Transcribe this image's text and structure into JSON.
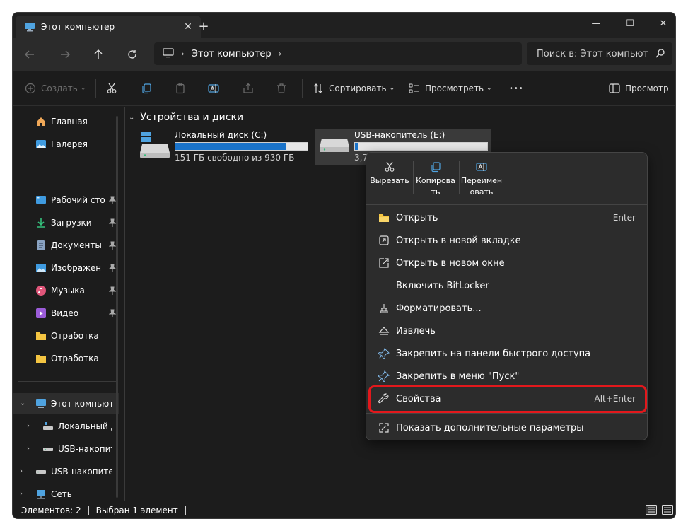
{
  "tab": {
    "title": "Этот компьютер",
    "close": "✕",
    "new": "+"
  },
  "window_controls": {
    "minimize": "—",
    "maximize": "☐",
    "close": "✕"
  },
  "address": {
    "path": "Этот компьютер"
  },
  "search": {
    "placeholder": "Поиск в: Этот компьют"
  },
  "toolbar": {
    "create": "Создать",
    "sort": "Сортировать",
    "view": "Просмотреть",
    "more": "•••",
    "preview": "Просмотр"
  },
  "sidebar": {
    "items": [
      {
        "label": "Главная"
      },
      {
        "label": "Галерея"
      },
      {
        "label": "Рабочий стол"
      },
      {
        "label": "Загрузки"
      },
      {
        "label": "Документы"
      },
      {
        "label": "Изображения"
      },
      {
        "label": "Музыка"
      },
      {
        "label": "Видео"
      },
      {
        "label": "Отработка"
      },
      {
        "label": "Отработка"
      },
      {
        "label": "Этот компьютер"
      },
      {
        "label": "Локальный диск (C:)"
      },
      {
        "label": "USB-накопитель (E:)"
      },
      {
        "label": "USB-накопитель (E:)"
      },
      {
        "label": "Сеть"
      }
    ]
  },
  "content": {
    "section_title": "Устройства и диски",
    "drives": [
      {
        "name": "Локальный диск (C:)",
        "info": "151 ГБ свободно из 930 ГБ",
        "used_fraction": 0.84
      },
      {
        "name": "USB-накопитель (E:)",
        "info": "3,7",
        "used_fraction": 0.02
      }
    ]
  },
  "context_menu": {
    "top": [
      {
        "label": "Вырезать"
      },
      {
        "label": "Копировать"
      },
      {
        "label": "Переименовать"
      }
    ],
    "items": [
      {
        "label": "Открыть",
        "shortcut": "Enter"
      },
      {
        "label": "Открыть в новой вкладке"
      },
      {
        "label": "Открыть в новом окне"
      },
      {
        "label": "Включить BitLocker"
      },
      {
        "label": "Форматировать..."
      },
      {
        "label": "Извлечь"
      },
      {
        "label": "Закрепить на панели быстрого доступа"
      },
      {
        "label": "Закрепить в меню \"Пуск\""
      },
      {
        "label": "Свойства",
        "shortcut": "Alt+Enter"
      },
      {
        "label": "Показать дополнительные параметры"
      }
    ]
  },
  "status": {
    "count": "Элементов: 2",
    "selected": "Выбран 1 элемент"
  },
  "colors": {
    "accent": "#1a73c9",
    "highlight": "#e2181c",
    "folder": "#f4c542"
  }
}
